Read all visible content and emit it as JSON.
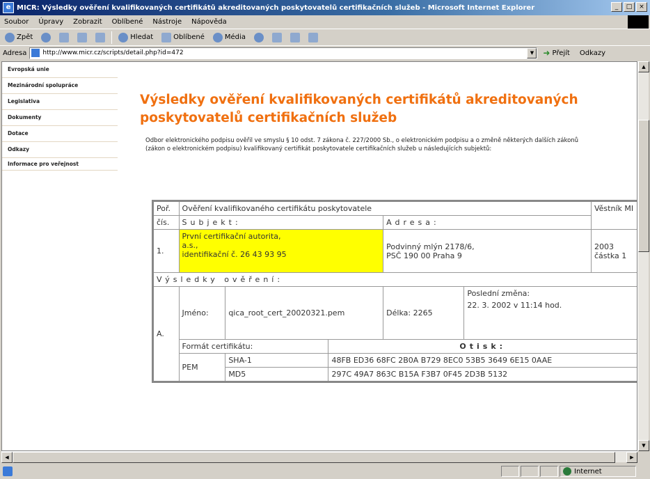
{
  "window": {
    "title": "MIČR: Výsledky ověření kvalifikovaných certifikátů akreditovaných poskytovatelů certifikačních služeb - Microsoft Internet Explorer",
    "controls": [
      "_",
      "□",
      "×"
    ]
  },
  "menu": [
    "Soubor",
    "Úpravy",
    "Zobrazit",
    "Oblíbené",
    "Nástroje",
    "Nápověda"
  ],
  "toolbar": {
    "back": "Zpět",
    "search": "Hledat",
    "favorites": "Oblíbené",
    "media": "Média"
  },
  "address": {
    "label": "Adresa",
    "url": "http://www.micr.cz/scripts/detail.php?id=472",
    "go": "Přejít",
    "links": "Odkazy"
  },
  "sidebar": {
    "items": [
      "Evropská unie",
      "Mezinárodní spolupráce",
      "Legislativa",
      "Dokumenty",
      "Dotace",
      "Odkazy",
      "Informace pro veřejnost"
    ]
  },
  "page": {
    "title": "Výsledky ověření kvalifikovaných certifikátů akreditovaných poskytovatelů certifikačních služeb",
    "intro": "Odbor elektronického podpisu ověřil ve smyslu § 10 odst. 7 zákona č. 227/2000 Sb., o elektronickém podpisu a o změně některých dalších zákonů (zákon o elektronickém podpisu) kvalifikovaný certifikát poskytovatele certifikačních služeb u následujících subjektů:"
  },
  "table": {
    "col_por": "Poř.",
    "col_cis": "čís.",
    "header_overeni": "Ověření kvalifikovaného certifikátu poskytovatele",
    "col_vestnik": "Věstník MI",
    "col_subjekt": "Subjekt:",
    "col_adresa": "Adresa:",
    "row_num": "1.",
    "subjekt_lines": [
      "První certifikační autorita,",
      "a.s.,",
      "identifikační č. 26 43 93 95"
    ],
    "adresa_lines": [
      "Podvinný mlýn 2178/6,",
      "PSČ 190 00 Praha 9"
    ],
    "vestnik_lines": [
      "2003",
      "částka 1"
    ],
    "results_header": "Výsledky ověření:",
    "section_label": "A.",
    "jmeno_label": "Jméno:",
    "jmeno_value": "qica_root_cert_20020321.pem",
    "delka": "Délka: 2265",
    "posledni_zmena_label": "Poslední změna:",
    "posledni_zmena_value": "22. 3. 2002 v 11:14 hod.",
    "format_label": "Formát certifikátu:",
    "otisk_label": "Otisk:",
    "format_value": "PEM",
    "sha1_label": "SHA-1",
    "sha1_value": "48FB ED36 68FC 2B0A B729 8EC0 53B5 3649 6E15 0AAE",
    "md5_label": "MD5",
    "md5_value": "297C 49A7 863C B15A F3B7 0F45 2D3B 5132"
  },
  "status": {
    "zone": "Internet"
  }
}
